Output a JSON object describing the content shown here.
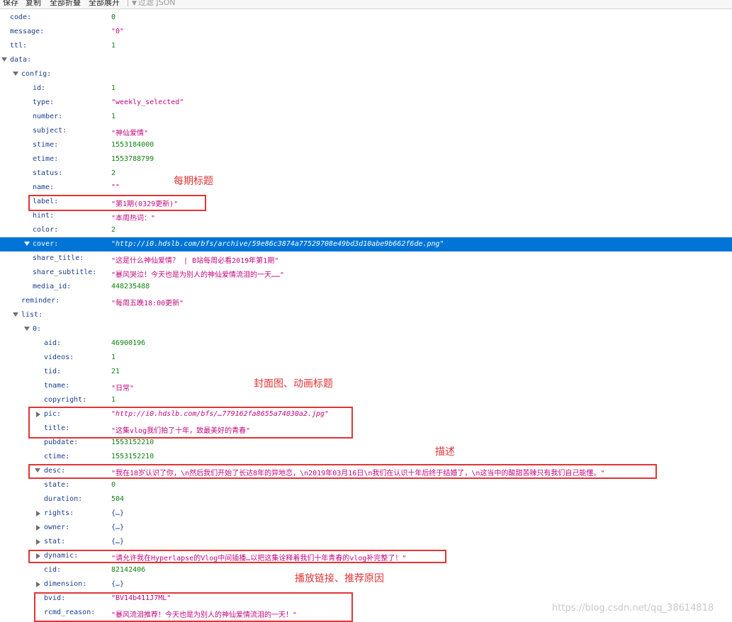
{
  "toolbar": {
    "save": "保存",
    "copy": "复制",
    "collapse_all": "全部折叠",
    "expand_all": "全部展开",
    "filter_placeholder": "过滤 JSON"
  },
  "tree": [
    {
      "key": "code:",
      "value": "0",
      "type": "num"
    },
    {
      "key": "message:",
      "value": "\"0\"",
      "type": "str"
    },
    {
      "key": "ttl:",
      "value": "1",
      "type": "num"
    },
    {
      "key": "data:",
      "value": "",
      "type": "expanded"
    },
    {
      "key": "config:",
      "value": "",
      "type": "expanded"
    },
    {
      "key": "id:",
      "value": "1",
      "type": "num"
    },
    {
      "key": "type:",
      "value": "\"weekly_selected\"",
      "type": "str"
    },
    {
      "key": "number:",
      "value": "1",
      "type": "num"
    },
    {
      "key": "subject:",
      "value": "\"神仙爱情\"",
      "type": "str"
    },
    {
      "key": "stime:",
      "value": "1553184000",
      "type": "num"
    },
    {
      "key": "etime:",
      "value": "1553788799",
      "type": "num"
    },
    {
      "key": "status:",
      "value": "2",
      "type": "num"
    },
    {
      "key": "name:",
      "value": "\"\"",
      "type": "str"
    },
    {
      "key": "label:",
      "value": "\"第1期(0329更新)\"",
      "type": "str"
    },
    {
      "key": "hint:",
      "value": "\"本周热词：\"",
      "type": "str"
    },
    {
      "key": "color:",
      "value": "2",
      "type": "num"
    },
    {
      "key": "cover:",
      "value": "\"http://i0.hdslb.com/bfs/archive/59e86c3874a77529708e49bd3d10abe9b662f6de.png\"",
      "type": "url",
      "selected": true
    },
    {
      "key": "share_title:",
      "value": "\"这是什么神仙爱情？ | B站每周必看2019年第1期\"",
      "type": "str"
    },
    {
      "key": "share_subtitle:",
      "value": "\"暴风哭泣！今天也是为别人的神仙爱情流泪的一天……\"",
      "type": "str"
    },
    {
      "key": "media_id:",
      "value": "448235488",
      "type": "num"
    },
    {
      "key": "reminder:",
      "value": "\"每周五晚18:00更新\"",
      "type": "str"
    },
    {
      "key": "list:",
      "value": "",
      "type": "expanded"
    },
    {
      "key": "0:",
      "value": "",
      "type": "expanded"
    },
    {
      "key": "aid:",
      "value": "46900196",
      "type": "num"
    },
    {
      "key": "videos:",
      "value": "1",
      "type": "num"
    },
    {
      "key": "tid:",
      "value": "21",
      "type": "num"
    },
    {
      "key": "tname:",
      "value": "\"日常\"",
      "type": "str"
    },
    {
      "key": "copyright:",
      "value": "1",
      "type": "num"
    },
    {
      "key": "pic:",
      "value": "\"http://i0.hdslb.com/bfs/…779162fa8655a74030a2.jpg\"",
      "type": "url"
    },
    {
      "key": "title:",
      "value": "\"这集vlog我们拍了十年，致最美好的青春\"",
      "type": "str"
    },
    {
      "key": "pubdate:",
      "value": "1553152210",
      "type": "num"
    },
    {
      "key": "ctime:",
      "value": "1553152210",
      "type": "num"
    },
    {
      "key": "desc:",
      "value": "\"我在18岁认识了你，\\n然后我们开始了长达8年的异地恋，\\n2019年03月16日\\n我们在认识十年后终于结婚了，\\n这当中的酸甜苦辣只有我们自己能懂。\"",
      "type": "str"
    },
    {
      "key": "state:",
      "value": "0",
      "type": "num"
    },
    {
      "key": "duration:",
      "value": "504",
      "type": "num"
    },
    {
      "key": "rights:",
      "value": "{…}",
      "type": "obj"
    },
    {
      "key": "owner:",
      "value": "{…}",
      "type": "obj"
    },
    {
      "key": "stat:",
      "value": "{…}",
      "type": "obj"
    },
    {
      "key": "dynamic:",
      "value": "\"请允许我在Hyperlapse的Vlog中间插播…以把这集诠释着我们十年青春的vlog补完整了！\"",
      "type": "str"
    },
    {
      "key": "cid:",
      "value": "82142406",
      "type": "num"
    },
    {
      "key": "dimension:",
      "value": "{…}",
      "type": "obj"
    },
    {
      "key": "bvid:",
      "value": "\"BV14b411J7ML\"",
      "type": "str"
    },
    {
      "key": "rcmd_reason:",
      "value": "\"暴风流泪推荐！今天也是为别人的神仙爱情流泪的一天！\"",
      "type": "str"
    }
  ],
  "annotations": {
    "label_note": "每期标题",
    "cover_title_note": "封面图、动画标题",
    "desc_note": "描述",
    "link_reason_note": "播放链接、推荐原因"
  },
  "watermark": "https://blog.csdn.net/qq_38614818"
}
